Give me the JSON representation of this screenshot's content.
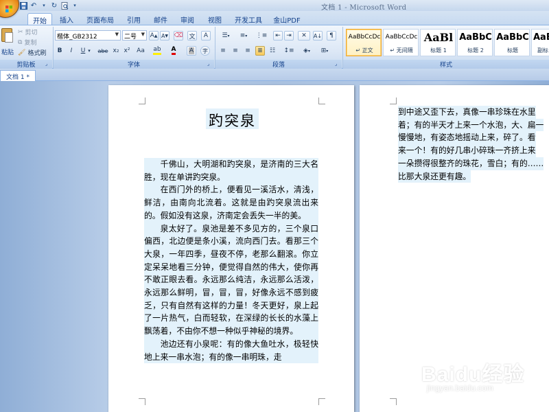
{
  "window": {
    "title": "文档 1 - Microsoft Word"
  },
  "quick_access": {
    "save_icon": "save-icon",
    "undo_icon": "undo-icon",
    "redo_icon": "redo-icon",
    "print_preview_icon": "print-preview-icon"
  },
  "ribbon_tabs": [
    {
      "label": "开始",
      "active": true
    },
    {
      "label": "插入"
    },
    {
      "label": "页面布局"
    },
    {
      "label": "引用"
    },
    {
      "label": "邮件"
    },
    {
      "label": "审阅"
    },
    {
      "label": "视图"
    },
    {
      "label": "开发工具"
    },
    {
      "label": "金山PDF"
    }
  ],
  "clipboard": {
    "paste_label": "粘贴",
    "cut_label": "剪切",
    "copy_label": "复制",
    "format_painter_label": "格式刷",
    "group_label": "剪贴板"
  },
  "font": {
    "font_name": "楷体_GB2312",
    "font_size": "二号",
    "group_label": "字体",
    "bold": "B",
    "italic": "I",
    "underline": "U",
    "strike": "abe",
    "subscript": "x₂",
    "superscript": "x²",
    "change_case": "Aa",
    "grow": "A",
    "shrink": "A",
    "clear": "A"
  },
  "paragraph": {
    "group_label": "段落"
  },
  "styles": {
    "group_label": "样式",
    "items": [
      {
        "sample": "AaBbCcDc",
        "name": "↵ 正文",
        "selected": true
      },
      {
        "sample": "AaBbCcDc",
        "name": "↵ 无间隔"
      },
      {
        "sample": "AaBl",
        "name": "标题 1"
      },
      {
        "sample": "AaBbC",
        "name": "标题 2"
      },
      {
        "sample": "AaBbC",
        "name": "标题"
      },
      {
        "sample": "AaBbC",
        "name": "副标"
      }
    ]
  },
  "doc_tabs": [
    {
      "label": "文档 1 *"
    }
  ],
  "document": {
    "title": "趵突泉",
    "paragraphs": [
      "千佛山，大明湖和趵突泉，是济南的三大名胜，现在单讲趵突泉。",
      "在西门外的桥上，便看见一溪活水，清浅，鲜洁，由南向北流着。这就是由趵突泉流出来的。假如没有这泉，济南定会丢失一半的美。",
      "泉太好了。泉池是差不多见方的，三个泉口偏西，北边便是条小溪，流向西门去。看那三个大泉，一年四季，昼夜不停，老那么翻滚。你立定呆呆地看三分钟，便觉得自然的伟大，使你再不敢正眼去看。永远那么纯洁，永远那么活泼，永远那么鲜明，冒，冒，冒，好像永远不感到疲乏，只有自然有这样的力量！冬天更好，泉上起了一片热气，白而轻软，在深绿的长长的水藻上飘荡着，不由你不想一种似乎神秘的境界。",
      "池边还有小泉呢：有的像大鱼吐水，极轻快地上来一串水泡；有的像一串明珠，走"
    ],
    "page2_lines": [
      "到中途又歪下去，真像一串珍珠在水里",
      "着；有的半天才上来一个水泡，大、扁一",
      "慢慢地，有姿态地摇动上来，碎了。看",
      "来一个！有的好几串小碎珠一齐挤上来",
      "一朵攒得很整齐的珠花，雪白；有的……",
      "比那大泉还更有趣。"
    ]
  },
  "watermark": {
    "brand": "Baidu经验",
    "url": "jingyan.baidu.com"
  }
}
